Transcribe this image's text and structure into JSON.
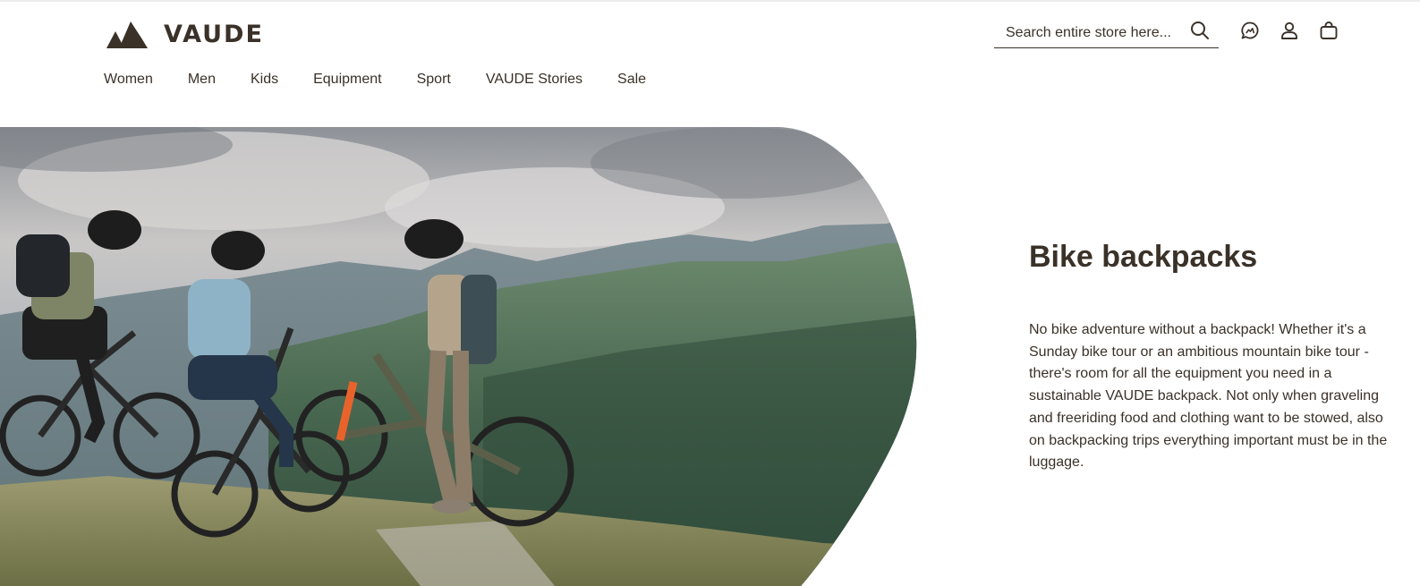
{
  "header": {
    "logo_text": "VAUDE",
    "search": {
      "placeholder": "Search entire store here..."
    },
    "icons": [
      "search-icon",
      "chat-support-icon",
      "account-icon",
      "shopping-bag-icon"
    ]
  },
  "nav": {
    "items": [
      {
        "label": "Women"
      },
      {
        "label": "Men"
      },
      {
        "label": "Kids"
      },
      {
        "label": "Equipment"
      },
      {
        "label": "Sport"
      },
      {
        "label": "VAUDE Stories"
      },
      {
        "label": "Sale"
      }
    ]
  },
  "hero": {
    "image": "mountain-bikers-on-ridge-photo",
    "title": "Bike backpacks",
    "text": "No bike adventure without a backpack! Whether it's a Sunday bike tour or an ambitious mountain bike tour - there's room for all the equipment you need in a sustainable VAUDE backpack. Not only when graveling and freeriding food and clothing want to be stowed, also on backpacking trips everything important must be in the luggage."
  },
  "colors": {
    "brand_text": "#3a3128",
    "background": "#ffffff"
  }
}
